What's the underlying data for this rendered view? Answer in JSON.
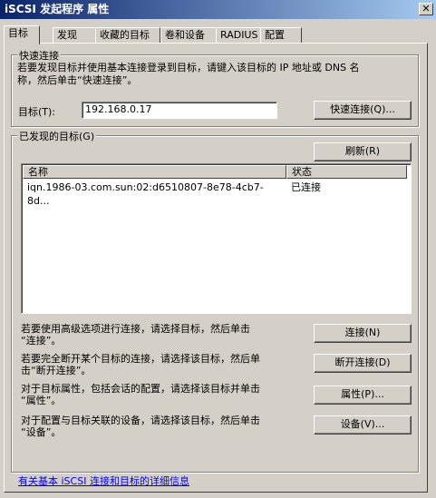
{
  "window": {
    "title": "iSCSI 发起程序 属性"
  },
  "tabs": [
    {
      "label": "目标"
    },
    {
      "label": "发现"
    },
    {
      "label": "收藏的目标"
    },
    {
      "label": "卷和设备"
    },
    {
      "label": "RADIUS"
    },
    {
      "label": "配置"
    }
  ],
  "quick_connect": {
    "group_label": "快速连接",
    "description_line1": "若要发现目标并使用基本连接登录到目标，请键入该目标的 IP 地址或 DNS 名",
    "description_line2": "称，然后单击“快速连接”。",
    "target_label": "目标(T):",
    "target_value": "192.168.0.17",
    "button_label": "快速连接(Q)..."
  },
  "discovered": {
    "group_label": "已发现的目标(G)",
    "refresh_label": "刷新(R)",
    "columns": {
      "name": "名称",
      "status": "状态"
    },
    "rows": [
      {
        "name": "iqn.1986-03.com.sun:02:d6510807-8e78-4cb7-8d...",
        "status": "已连接"
      }
    ]
  },
  "actions": [
    {
      "line1": "若要使用高级选项进行连接，请选择目标，然后单击",
      "line2": "“连接”。",
      "button": "连接(N)"
    },
    {
      "line1": "若要完全断开某个目标的连接，请选择该目标，然后单",
      "line2": "击“断开连接”。",
      "button": "断开连接(D)"
    },
    {
      "line1": "对于目标属性，包括会话的配置，请选择该目标并单击",
      "line2": "“属性”。",
      "button": "属性(P)..."
    },
    {
      "line1": "对于配置与目标关联的设备，请选择该目标，然后单击",
      "line2": "“设备”。",
      "button": "设备(V)..."
    }
  ],
  "footer": {
    "link": "有关基本 iSCSI 连接和目标的详细信息"
  }
}
